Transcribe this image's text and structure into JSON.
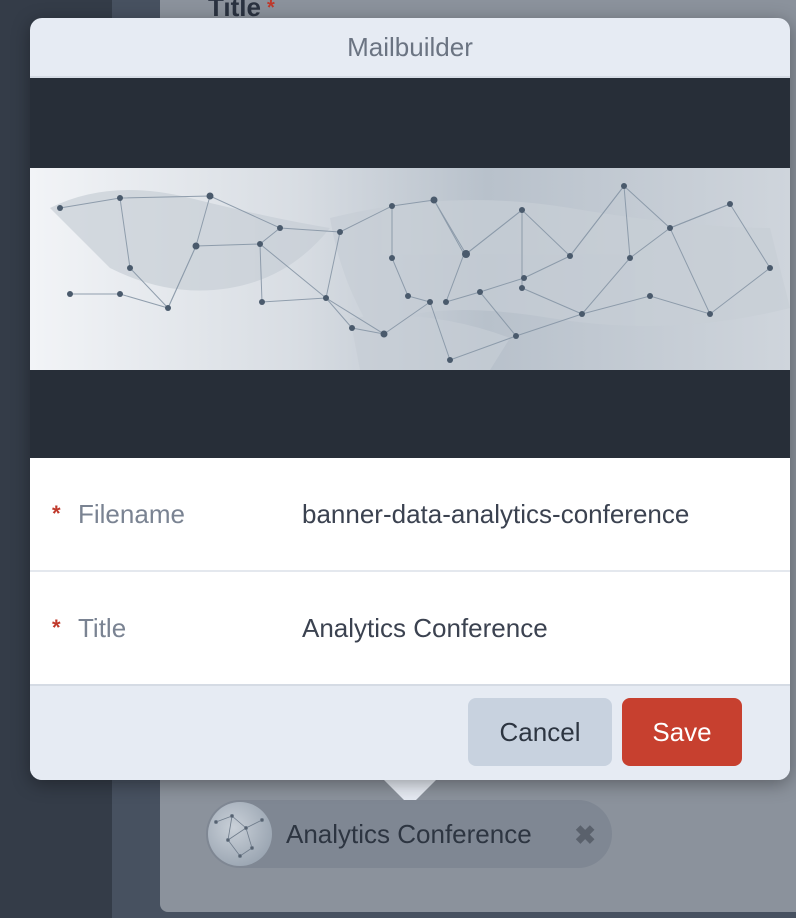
{
  "background": {
    "field_title": "Title",
    "required_mark": "*"
  },
  "modal": {
    "title": "Mailbuilder",
    "fields": [
      {
        "label": "Filename",
        "value": "banner-data-analytics-conference",
        "required": "*"
      },
      {
        "label": "Title",
        "value": "Analytics Conference",
        "required": "*"
      }
    ],
    "buttons": {
      "cancel": "Cancel",
      "save": "Save"
    }
  },
  "chip": {
    "label": "Analytics Conference",
    "remove_icon": "close-icon"
  },
  "colors": {
    "save": "#c7402f",
    "cancel": "#c8d2df",
    "required": "#c0392b"
  }
}
